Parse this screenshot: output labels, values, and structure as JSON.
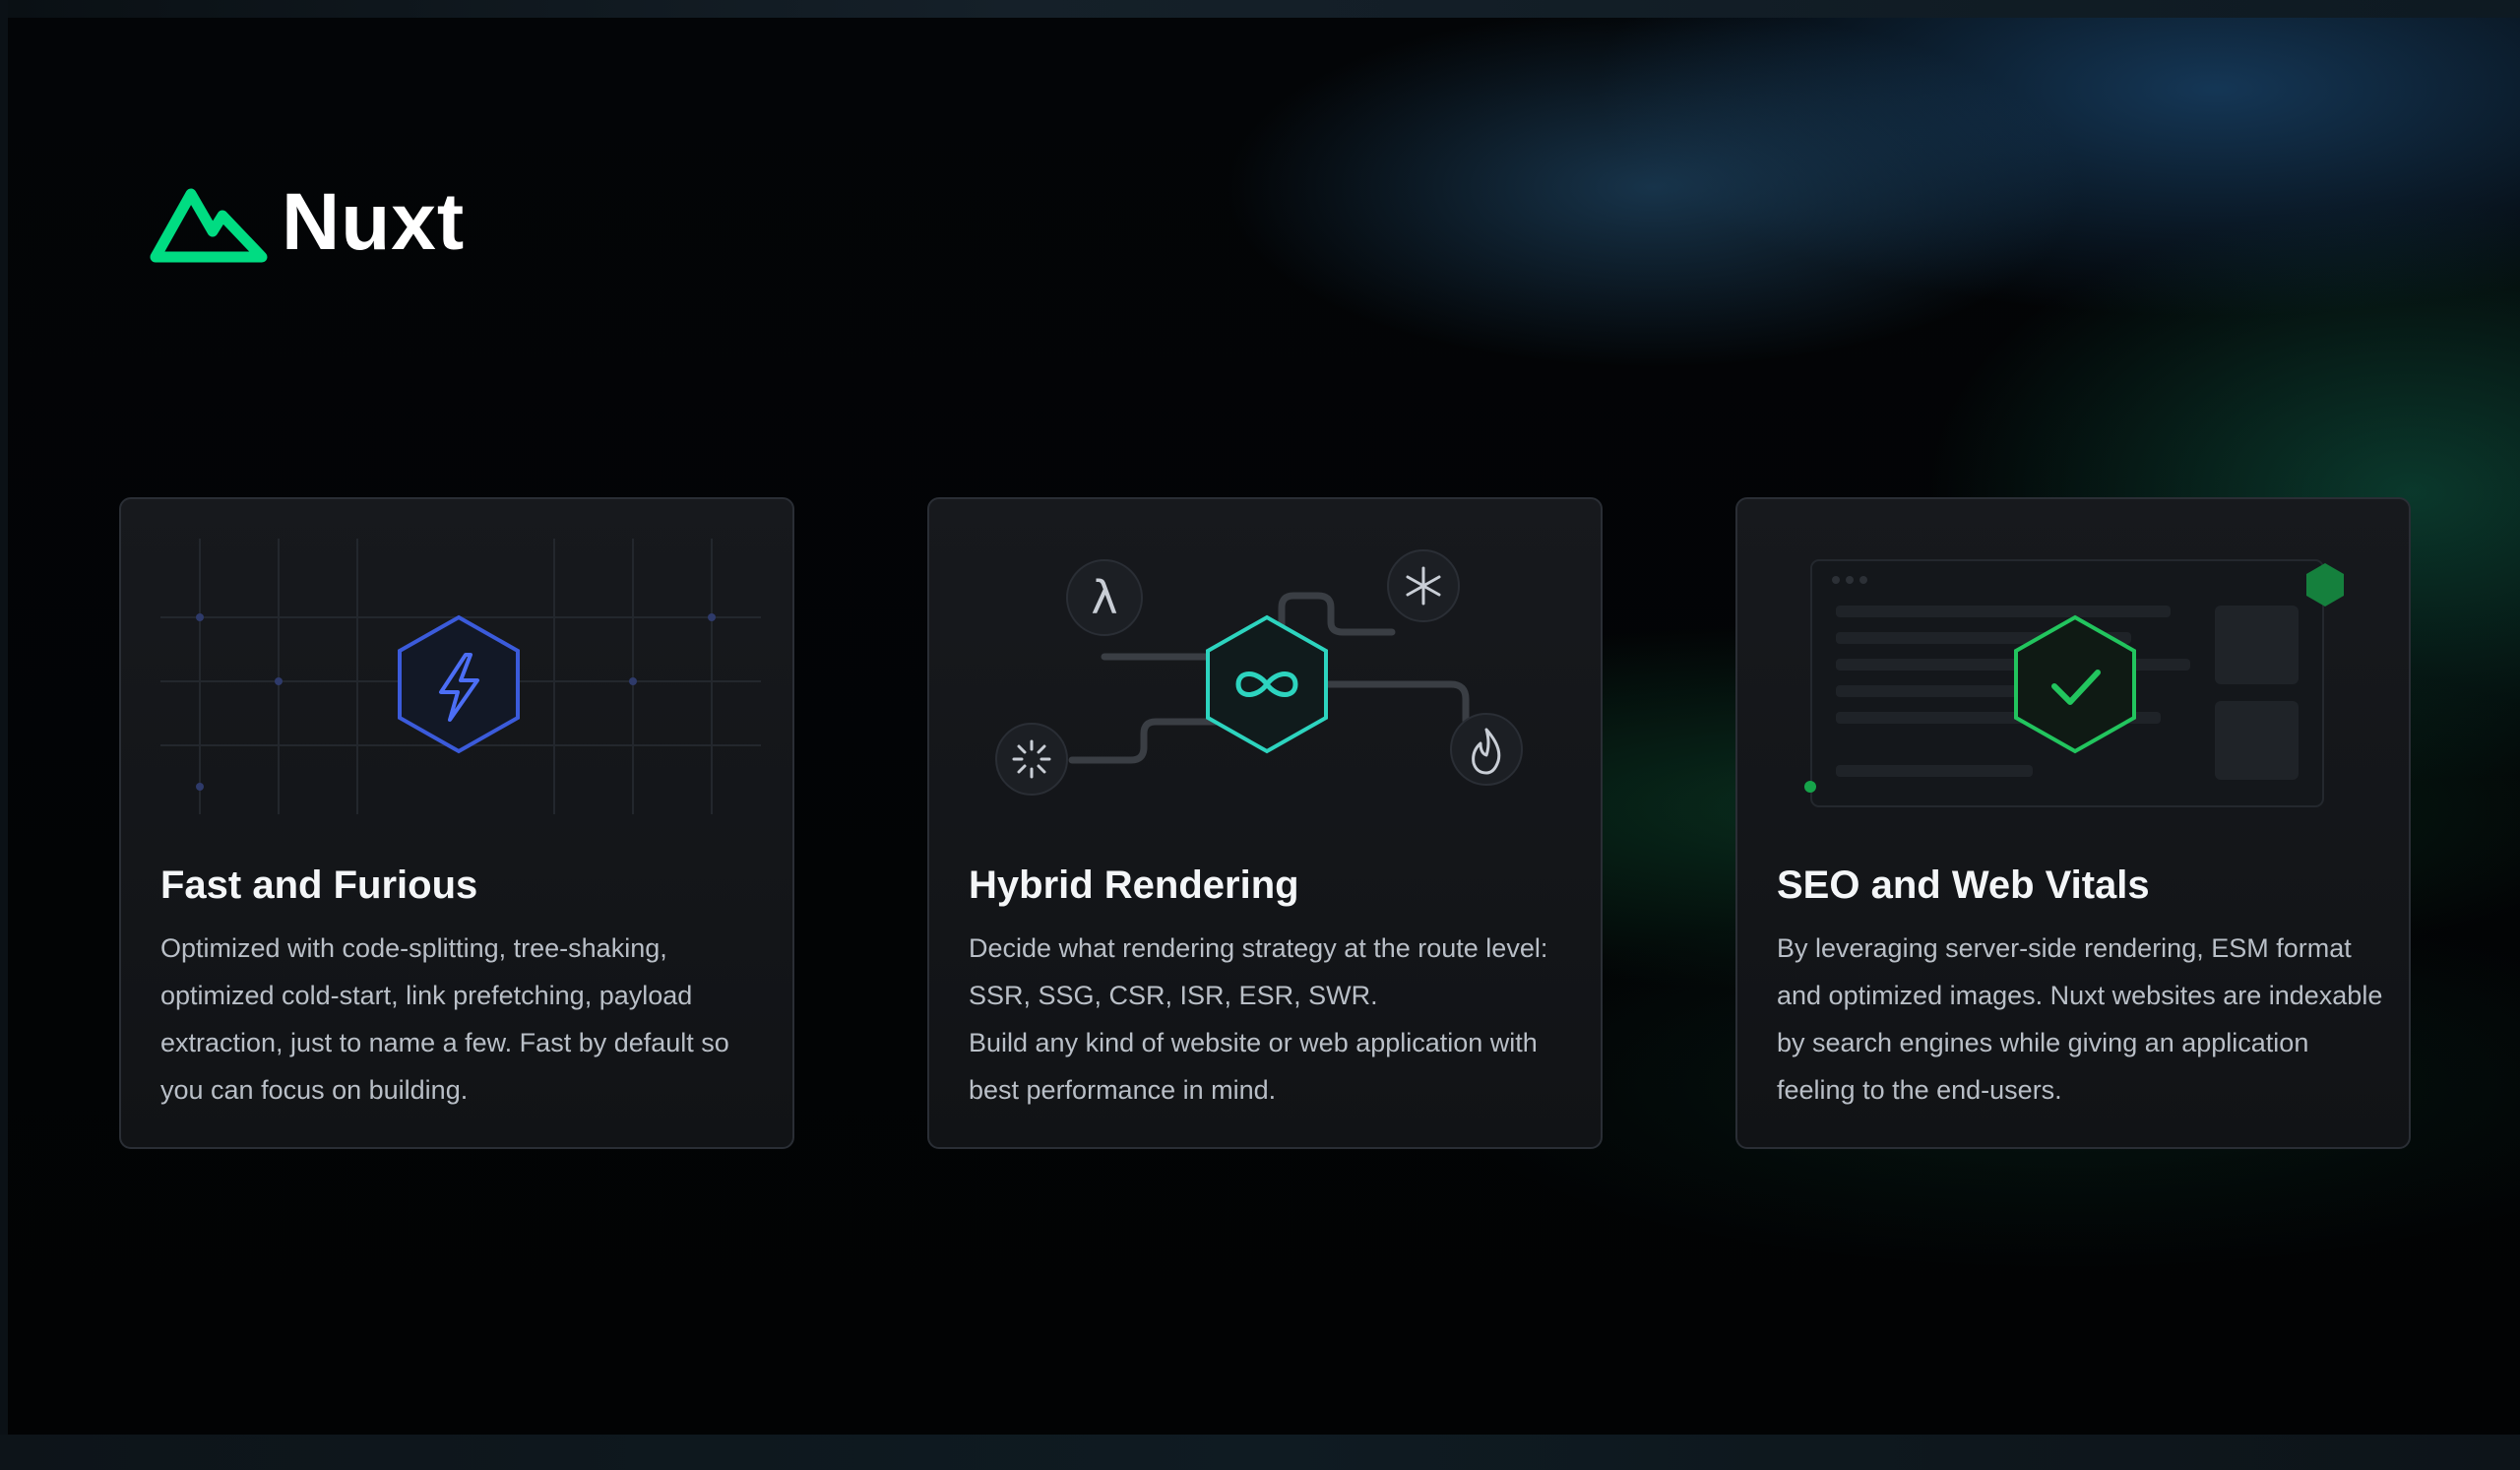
{
  "brand": {
    "name": "Nuxt",
    "accent": "#00DC82"
  },
  "cards": [
    {
      "title": "Fast and Furious",
      "description": "Optimized with code-splitting, tree-shaking, optimized cold-start, link prefetching, payload extraction, just to name a few. Fast by default so you can focus on building.",
      "icon": "lightning-icon",
      "color": "#3B5BDB"
    },
    {
      "title": "Hybrid Rendering",
      "description_lines": [
        "Decide what rendering strategy at the route level: SSR, SSG, CSR, ISR, ESR, SWR.",
        "Build any kind of website or web application with best performance in mind."
      ],
      "icon": "infinity-icon",
      "color": "#2DD4BF",
      "satellite_icons": [
        "lambda-icon",
        "snowflake-icon",
        "loading-icon",
        "flame-icon"
      ],
      "lambda_glyph": "λ"
    },
    {
      "title": "SEO and Web Vitals",
      "description": "By leveraging server-side rendering, ESM format and optimized images. Nuxt websites are indexable by search engines while giving an application feeling to the end-users.",
      "icon": "check-icon",
      "color": "#22C55E"
    }
  ]
}
